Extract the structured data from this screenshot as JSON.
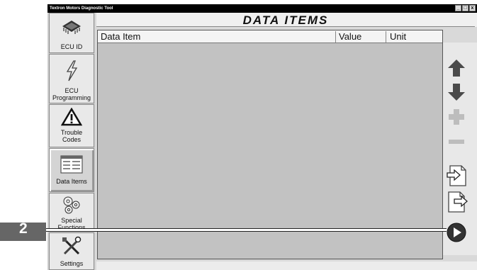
{
  "window": {
    "title": "Textron Motors Diagnostic Tool",
    "controls": {
      "minimize": "_",
      "maximize": "□",
      "close": "x"
    }
  },
  "header": {
    "title": "DATA ITEMS"
  },
  "nav": {
    "items": [
      {
        "id": "ecu-id",
        "label": "ECU ID",
        "icon": "chip-icon"
      },
      {
        "id": "ecu-programming",
        "label": "ECU\nProgramming",
        "icon": "lightning-icon"
      },
      {
        "id": "trouble-codes",
        "label": "Trouble\nCodes",
        "icon": "warning-triangle-icon"
      },
      {
        "id": "data-items",
        "label": "Data Items",
        "icon": "data-window-icon",
        "active": true
      },
      {
        "id": "special-functions",
        "label": "Special\nFunctions",
        "icon": "gears-icon"
      },
      {
        "id": "settings",
        "label": "Settings",
        "icon": "tools-icon"
      }
    ]
  },
  "table": {
    "columns": [
      "Data Item",
      "Value",
      "Unit"
    ],
    "rows": []
  },
  "right_buttons": [
    {
      "id": "scroll-up",
      "icon": "up-arrow-icon",
      "enabled": true
    },
    {
      "id": "scroll-down",
      "icon": "down-arrow-icon",
      "enabled": true
    },
    {
      "id": "add",
      "icon": "plus-icon",
      "enabled": false
    },
    {
      "id": "remove",
      "icon": "minus-icon",
      "enabled": false
    },
    {
      "id": "import",
      "icon": "import-icon",
      "enabled": true
    },
    {
      "id": "export",
      "icon": "export-icon",
      "enabled": true
    },
    {
      "id": "start",
      "icon": "play-icon",
      "enabled": true
    }
  ],
  "callout": {
    "number": "2"
  },
  "colors": {
    "accent": "#555555",
    "disabled": "#bdbdbd"
  }
}
